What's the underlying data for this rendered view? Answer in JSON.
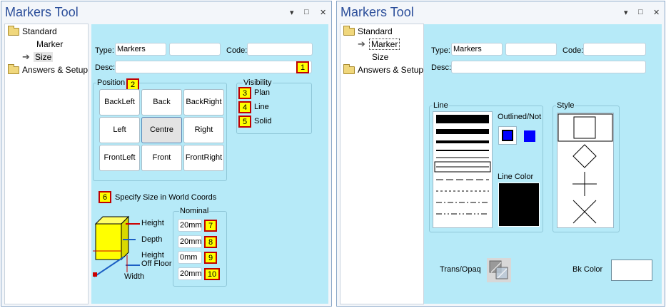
{
  "left": {
    "title": "Markers Tool",
    "controls": {
      "pin": "▾",
      "maximize": "□",
      "close": "✕"
    },
    "tree": [
      {
        "label": "Standard"
      },
      {
        "label": "Marker"
      },
      {
        "label": "Size"
      },
      {
        "label": "Answers & Setup"
      }
    ],
    "type_label": "Type:",
    "type_value": "Markers",
    "type2_value": "",
    "code_label": "Code:",
    "code_value": "",
    "desc_label": "Desc:",
    "desc_value": "",
    "position_title": "Position",
    "positions": [
      "BackLeft",
      "Back",
      "BackRight",
      "Left",
      "Centre",
      "Right",
      "FrontLeft",
      "Front",
      "FrontRight"
    ],
    "visibility_title": "Visibility",
    "visibility": [
      "Plan",
      "Line",
      "Solid"
    ],
    "specify_size": "Specify Size in World Coords",
    "nominal_title": "Nominal",
    "dims": [
      "Height",
      "Depth",
      "Height",
      "Off Floor",
      "Width"
    ],
    "nominal_values": [
      "20mm",
      "20mm",
      "0mm",
      "20mm"
    ],
    "badges": [
      "1",
      "2",
      "3",
      "4",
      "5",
      "6",
      "7",
      "8",
      "9",
      "10"
    ]
  },
  "right": {
    "title": "Markers Tool",
    "controls": {
      "pin": "▾",
      "maximize": "□",
      "close": "✕"
    },
    "tree": [
      {
        "label": "Standard"
      },
      {
        "label": "Marker"
      },
      {
        "label": "Size"
      },
      {
        "label": "Answers & Setup"
      }
    ],
    "type_label": "Type:",
    "type_value": "Markers",
    "type2_value": "",
    "code_label": "Code:",
    "code_value": "",
    "desc_label": "Desc:",
    "desc_value": "",
    "line_title": "Line",
    "outlined_label": "Outlined/Not",
    "line_color_label": "Line Color",
    "style_title": "Style",
    "trans_label": "Trans/Opaq",
    "bk_color_label": "Bk Color",
    "colors": {
      "line_color": "#000000",
      "outlined": "#0000ff",
      "bk_color": "#ffffff",
      "panel": "#b6eaf8"
    }
  }
}
